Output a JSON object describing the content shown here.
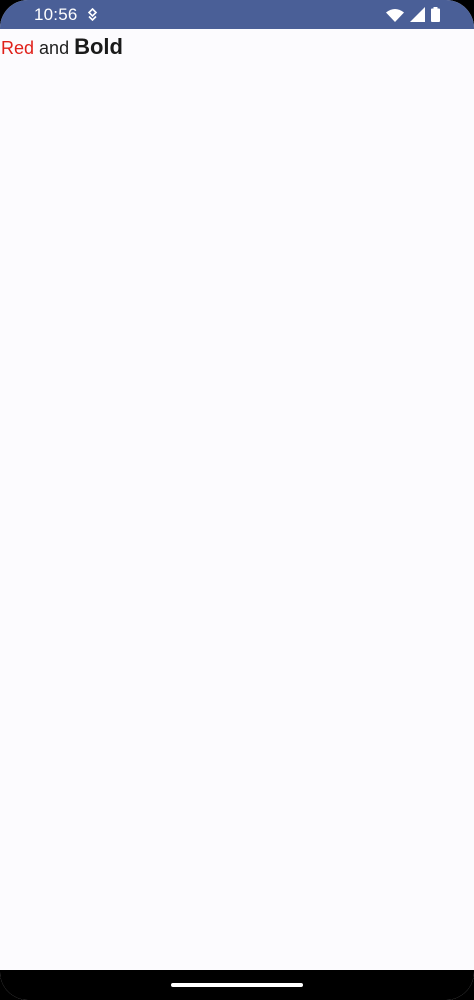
{
  "status_bar": {
    "time": "10:56",
    "notification_icon": "download-arrow-icon",
    "wifi_icon": "wifi-icon",
    "signal_icon": "cell-signal-icon",
    "battery_icon": "battery-icon",
    "bar_color": "#4a5f97"
  },
  "content": {
    "red_text": "Red",
    "middle_text": "and",
    "bold_text": "Bold",
    "red_color": "#e0201a",
    "background_color": "#fcfbfe"
  },
  "nav_bar": {
    "home_indicator_icon": "home-indicator"
  }
}
